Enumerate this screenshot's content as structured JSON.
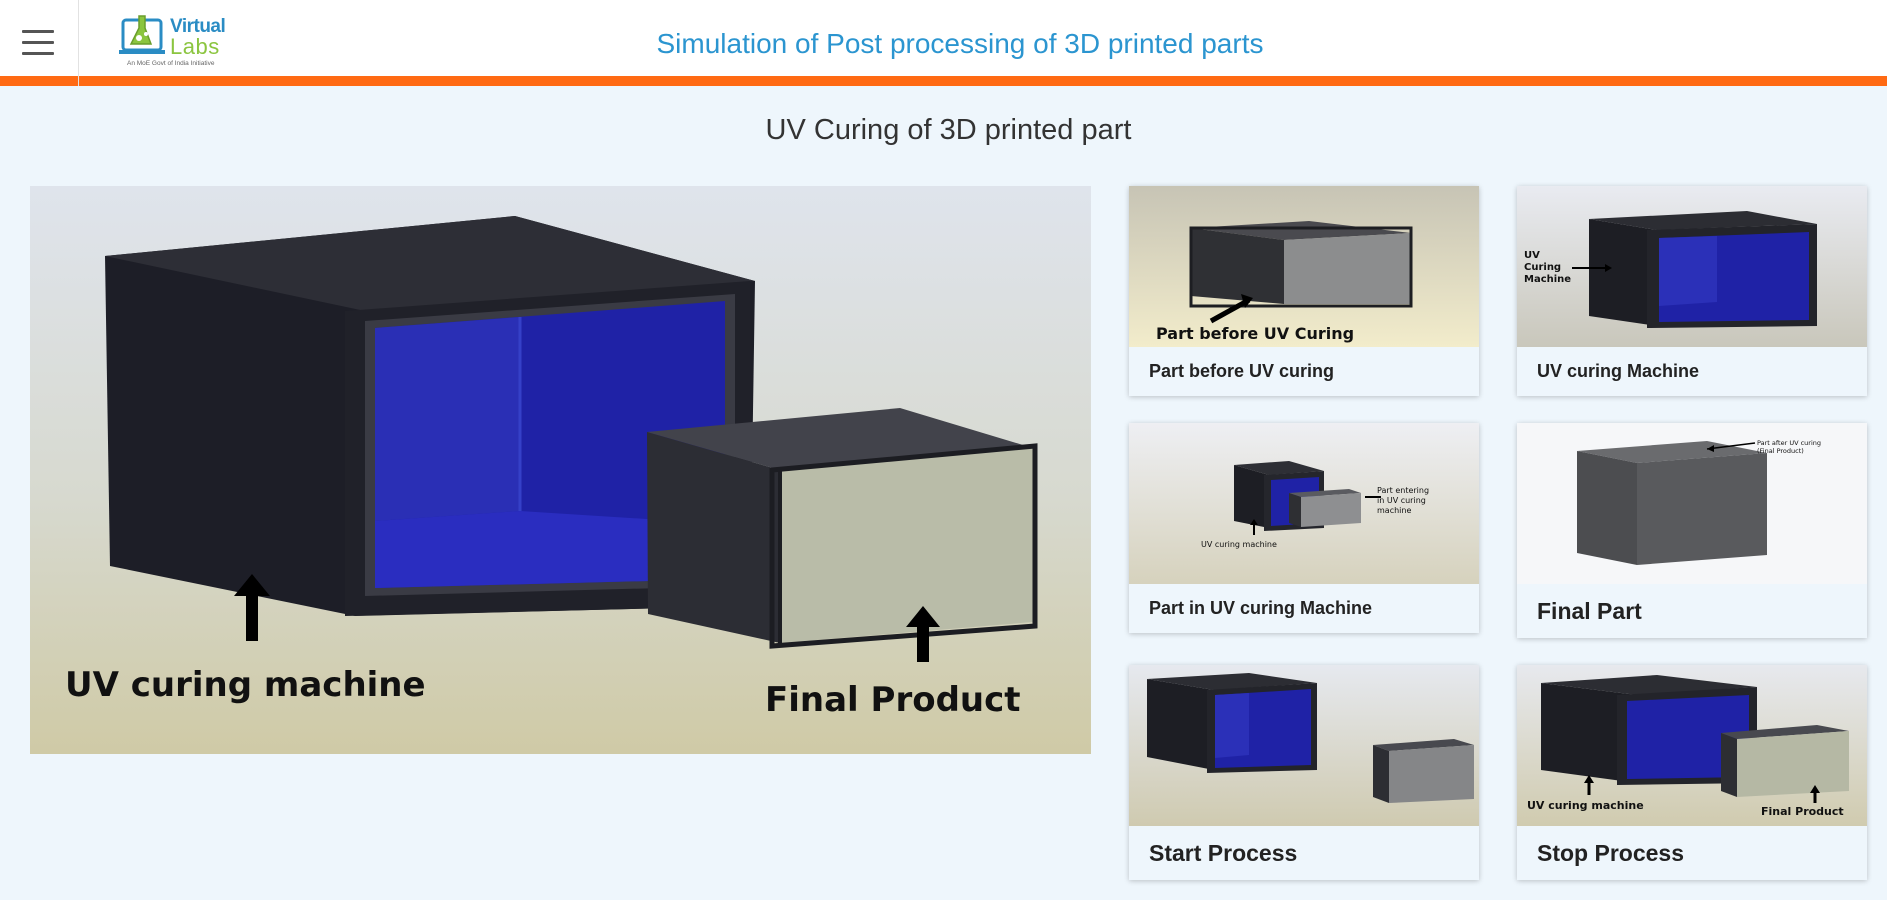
{
  "header": {
    "menu_icon": "hamburger-icon",
    "logo": {
      "line1": "Virtual",
      "line2": "Labs",
      "tagline": "An MoE Govt of India Initiative"
    },
    "title": "Simulation of Post processing of 3D printed parts"
  },
  "main": {
    "subtitle": "UV Curing of 3D printed part",
    "image_labels": {
      "machine": "UV curing machine",
      "product": "Final Product"
    }
  },
  "cards": [
    {
      "caption": "Part before UV curing",
      "image_text": "Part before UV Curing"
    },
    {
      "caption": "UV curing Machine",
      "image_text": "UV Curing Machine"
    },
    {
      "caption": "Part in UV curing Machine",
      "image_text_machine": "UV curing machine",
      "image_text_part": "Part entering in UV curing machine"
    },
    {
      "caption": "Final Part",
      "image_text": "Part after UV curing (Final Product)"
    },
    {
      "caption": "Start Process"
    },
    {
      "caption": "Stop Process",
      "image_text_machine": "UV curing machine",
      "image_text_part": "Final Product"
    }
  ],
  "colors": {
    "accent": "#ff6a13",
    "title": "#2b95d0",
    "background": "#eef6fc",
    "uv_blue": "#1f22a6"
  }
}
